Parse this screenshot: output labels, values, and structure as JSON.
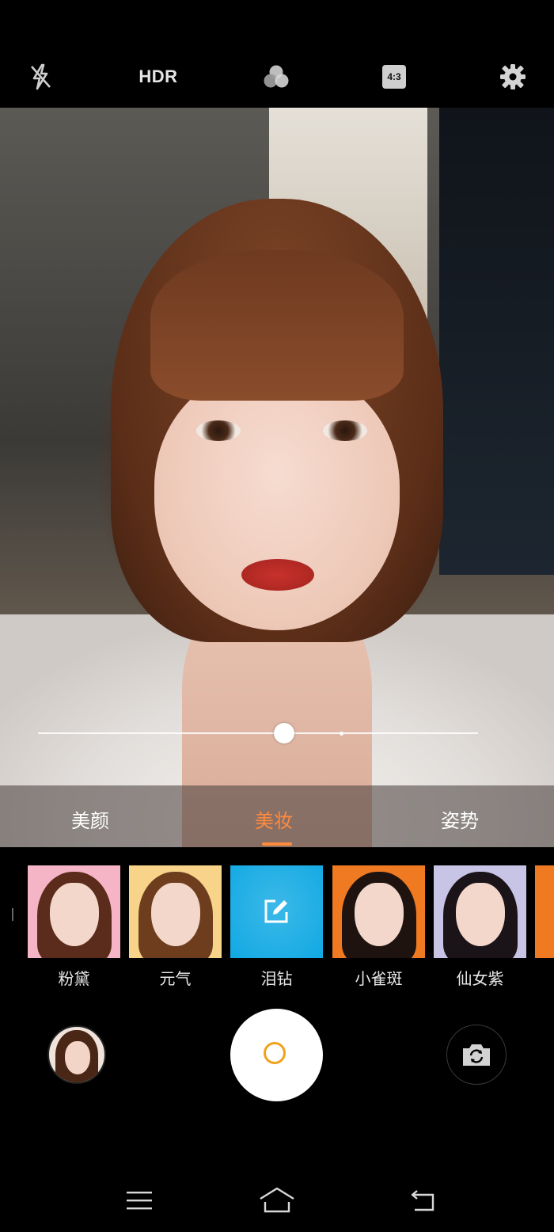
{
  "top_toolbar": {
    "flash_icon": "flash-off-icon",
    "hdr_label": "HDR",
    "filters_icon": "filters-icon",
    "ratio_label": "4:3",
    "settings_icon": "gear-icon"
  },
  "beauty_slider": {
    "value_fraction": 0.56,
    "default_fraction": 0.69
  },
  "modes": {
    "items": [
      "美颜",
      "美妆",
      "姿势"
    ],
    "active": "美妆"
  },
  "makeup_presets": [
    {
      "label": "粉黛",
      "bg": "#f6b5c6",
      "hair": "#5b2b1c"
    },
    {
      "label": "元气",
      "bg": "#f7d48a",
      "hair": "#6e3d1e"
    },
    {
      "label": "泪钻",
      "bg": "#11a9e3",
      "icon": "edit-icon",
      "selected": true
    },
    {
      "label": "小雀斑",
      "bg": "#f07a22",
      "hair": "#1e130f"
    },
    {
      "label": "仙女紫",
      "bg": "#c8c4e6",
      "hair": "#1a1318"
    }
  ],
  "colors": {
    "accent": "#ff8a3d",
    "shutter_ring": "#f0a21c"
  },
  "bottom_controls": {
    "gallery_icon": "gallery-thumbnail",
    "shutter_icon": "shutter-button",
    "switch_icon": "switch-camera-icon"
  },
  "navigation": {
    "menu_icon": "menu-icon",
    "home_icon": "home-icon",
    "back_icon": "back-icon"
  }
}
